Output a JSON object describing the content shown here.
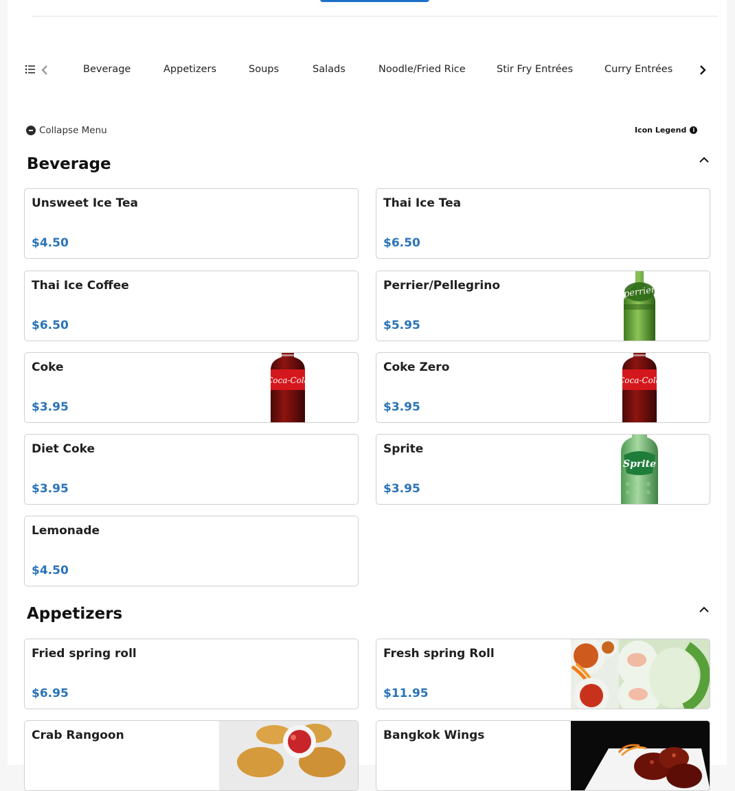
{
  "nav": {
    "tabs": [
      {
        "label": "Beverage"
      },
      {
        "label": "Appetizers"
      },
      {
        "label": "Soups"
      },
      {
        "label": "Salads"
      },
      {
        "label": "Noodle/Fried Rice"
      },
      {
        "label": "Stir Fry Entrées"
      },
      {
        "label": "Curry Entrées"
      }
    ]
  },
  "controls": {
    "collapse_label": "Collapse Menu",
    "legend_label": "Icon Legend",
    "legend_icon": "i"
  },
  "sections": [
    {
      "title": "Beverage",
      "items": [
        {
          "name": "Unsweet Ice Tea",
          "price": "$4.50"
        },
        {
          "name": "Thai Ice Tea",
          "price": "$6.50"
        },
        {
          "name": "Thai Ice Coffee",
          "price": "$6.50"
        },
        {
          "name": "Perrier/Pellegrino",
          "price": "$5.95",
          "image": "perrier-bottle"
        },
        {
          "name": "Coke",
          "price": "$3.95",
          "image": "coca-cola-bottle"
        },
        {
          "name": "Coke Zero",
          "price": "$3.95",
          "image": "coca-cola-bottle"
        },
        {
          "name": "Diet Coke",
          "price": "$3.95"
        },
        {
          "name": "Sprite",
          "price": "$3.95",
          "image": "sprite-bottle"
        },
        {
          "name": "Lemonade",
          "price": "$4.50"
        }
      ]
    },
    {
      "title": "Appetizers",
      "items": [
        {
          "name": "Fried spring roll",
          "price": "$6.95"
        },
        {
          "name": "Fresh spring Roll",
          "price": "$11.95",
          "image": "spring-roll-photo"
        },
        {
          "name": "Crab Rangoon",
          "price": "",
          "image": "crab-rangoon-photo"
        },
        {
          "name": "Bangkok Wings",
          "price": "",
          "image": "bangkok-wings-photo"
        }
      ]
    }
  ],
  "colors": {
    "accent": "#1e6fc9",
    "price": "#2a73b8",
    "border": "#cfcfcf"
  }
}
